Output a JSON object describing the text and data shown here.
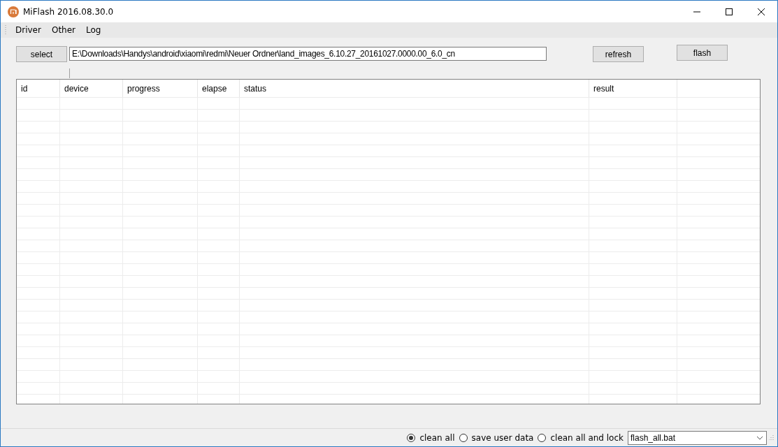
{
  "window": {
    "title": "MiFlash 2016.08.30.0"
  },
  "menu": [
    "Driver",
    "Other",
    "Log"
  ],
  "toolbar": {
    "select_button": "select",
    "path": {
      "value": "E:\\Downloads\\Handys\\android\\xiaomi\\redmi\\Neuer Ordner\\land_images_6.10.27_20161027.0000.00_6.0_cn"
    },
    "refresh_button": "refresh",
    "flash_button": "flash"
  },
  "table": {
    "columns": [
      "id",
      "device",
      "progress",
      "elapse",
      "status",
      "result"
    ]
  },
  "options": [
    {
      "label": "clean all",
      "selected": true
    },
    {
      "label": "save user data",
      "selected": false
    },
    {
      "label": "clean all and lock",
      "selected": false
    }
  ],
  "script_select": {
    "value": "flash_all.bat"
  }
}
